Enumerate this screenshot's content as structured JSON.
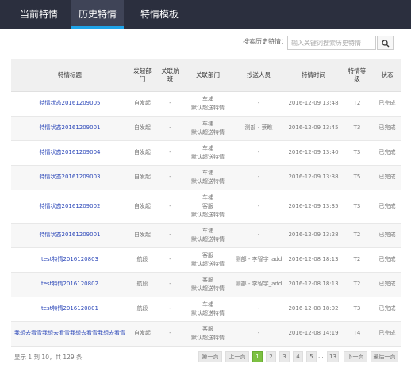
{
  "tabs": [
    "当前特情",
    "历史特情",
    "特情模板"
  ],
  "search": {
    "label": "搜索历史特情：",
    "placeholder": "输入关键词搜索历史特情"
  },
  "table": {
    "headers": [
      "特情标题",
      "发起部门",
      "关联航班",
      "关联部门",
      "抄送人员",
      "特情时间",
      "特情等级",
      "状态"
    ],
    "rows": [
      {
        "title": "特情状态20161209005",
        "dept": "自发起",
        "flight": "-",
        "related": [
          "车埔",
          "默认超送特情"
        ],
        "cc": "-",
        "time": "2016-12-09 13:48",
        "level": "T2",
        "status": "已完成"
      },
      {
        "title": "特情状态20161209001",
        "dept": "自发起",
        "flight": "-",
        "related": [
          "车埔",
          "默认超送特情"
        ],
        "cc": "测部 - 蔡瞧",
        "time": "2016-12-09 13:45",
        "level": "T3",
        "status": "已完成"
      },
      {
        "title": "特情状态20161209004",
        "dept": "自发起",
        "flight": "-",
        "related": [
          "车埔",
          "默认超送特情"
        ],
        "cc": "-",
        "time": "2016-12-09 13:40",
        "level": "T3",
        "status": "已完成"
      },
      {
        "title": "特情状态20161209003",
        "dept": "自发起",
        "flight": "-",
        "related": [
          "车埔",
          "默认超送特情"
        ],
        "cc": "-",
        "time": "2016-12-09 13:38",
        "level": "T5",
        "status": "已完成"
      },
      {
        "title": "特情状态20161209002",
        "dept": "自发起",
        "flight": "-",
        "related": [
          "车埔",
          "客服",
          "默认超送特情"
        ],
        "cc": "-",
        "time": "2016-12-09 13:35",
        "level": "T3",
        "status": "已完成"
      },
      {
        "title": "特情状态20161209001",
        "dept": "自发起",
        "flight": "-",
        "related": [
          "车埔",
          "默认超送特情"
        ],
        "cc": "-",
        "time": "2016-12-09 13:28",
        "level": "T2",
        "status": "已完成"
      },
      {
        "title": "test特情2016120803",
        "dept": "航段",
        "flight": "-",
        "related": [
          "客服",
          "默认超送特情"
        ],
        "cc": "测部 - 李智宇_add",
        "time": "2016-12-08 18:13",
        "level": "T2",
        "status": "已完成"
      },
      {
        "title": "test特情2016120802",
        "dept": "航段",
        "flight": "-",
        "related": [
          "客服",
          "默认超送特情"
        ],
        "cc": "测部 - 李智宇_add",
        "time": "2016-12-08 18:13",
        "level": "T2",
        "status": "已完成"
      },
      {
        "title": "test特情2016120801",
        "dept": "航段",
        "flight": "-",
        "related": [
          "车埔",
          "默认超送特情"
        ],
        "cc": "-",
        "time": "2016-12-08 18:02",
        "level": "T3",
        "status": "已完成"
      },
      {
        "title": "我想去看雪我想去看雪我想去看雪我想去看雪",
        "dept": "自发起",
        "flight": "-",
        "related": [
          "客服",
          "默认超送特情"
        ],
        "cc": "-",
        "time": "2016-12-08 14:19",
        "level": "T4",
        "status": "已完成"
      }
    ]
  },
  "footer": {
    "info": "显示 1 到 10，共 129 条",
    "pager": {
      "first": "第一页",
      "prev": "上一页",
      "pages": [
        "1",
        "2",
        "3",
        "4",
        "5"
      ],
      "ellipsis": "...",
      "last_page": "13",
      "next": "下一页",
      "last": "最后一页"
    }
  },
  "colors": {
    "topbar": "#2b2f3e",
    "active_tab_line": "#1fa3e8",
    "link": "#2a46b8",
    "active_page": "#7dc142"
  },
  "icons": {
    "search_button": "search-icon"
  }
}
